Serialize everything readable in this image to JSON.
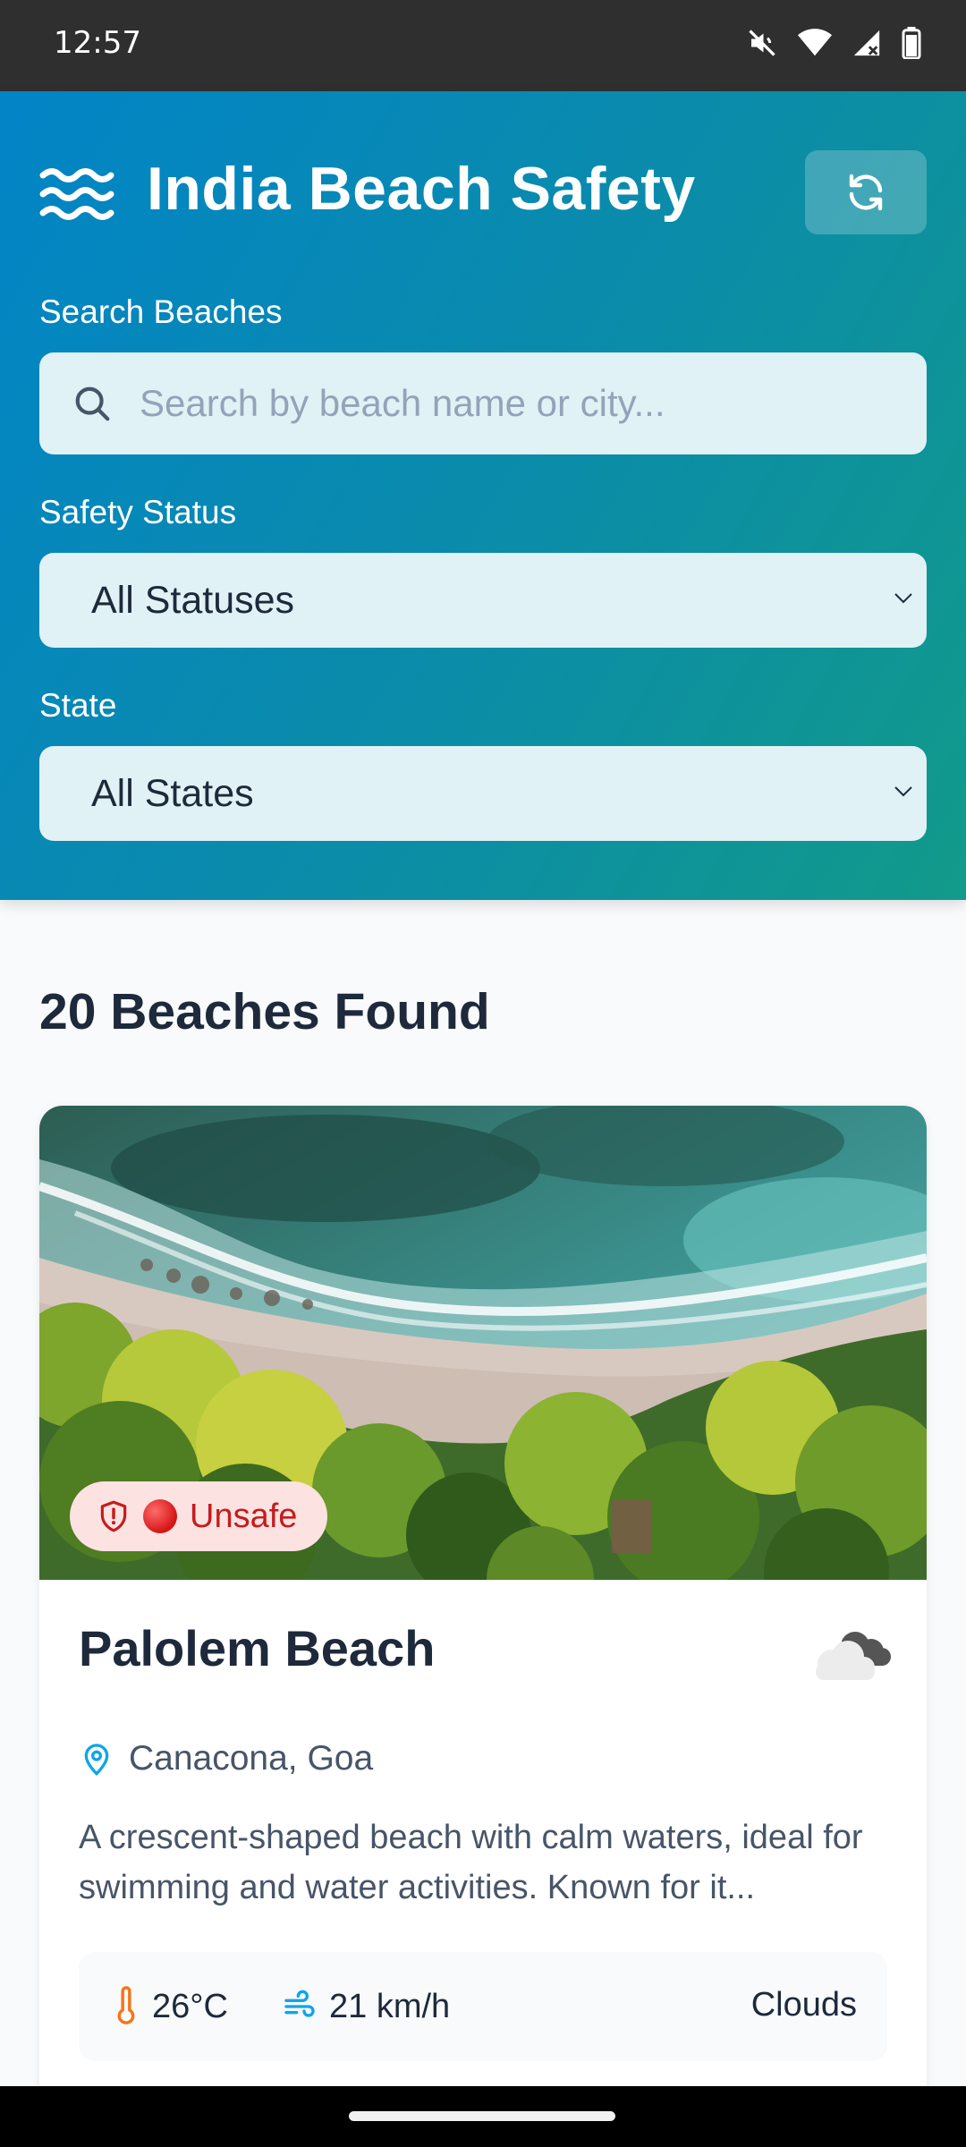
{
  "status_bar": {
    "time": "12:57",
    "icons": [
      "mute-icon",
      "wifi-icon",
      "signal-icon",
      "battery-icon"
    ]
  },
  "header": {
    "title": "India Beach Safety",
    "logo_icon": "waves-icon",
    "refresh_icon": "refresh-icon"
  },
  "filters": {
    "search_label": "Search Beaches",
    "search_placeholder": "Search by beach name or city...",
    "search_value": "",
    "status_label": "Safety Status",
    "status_value": "All Statuses",
    "state_label": "State",
    "state_value": "All States"
  },
  "results": {
    "title": "20 Beaches Found"
  },
  "card": {
    "status_badge": "Unsafe",
    "name": "Palolem Beach",
    "location": "Canacona, Goa",
    "description": "A crescent-shaped beach with calm waters, ideal for swimming and water activities. Known for it...",
    "weather": {
      "temperature": "26°C",
      "wind": "21 km/h",
      "condition": "Clouds"
    }
  },
  "colors": {
    "header_gradient_start": "#0284c7",
    "header_gradient_end": "#129a8a",
    "unsafe_badge_bg": "#fde2e2",
    "unsafe_text": "#c41c1c",
    "location_icon": "#0ea5e9",
    "temperature_icon": "#f97316",
    "wind_icon": "#0ea5e9"
  }
}
